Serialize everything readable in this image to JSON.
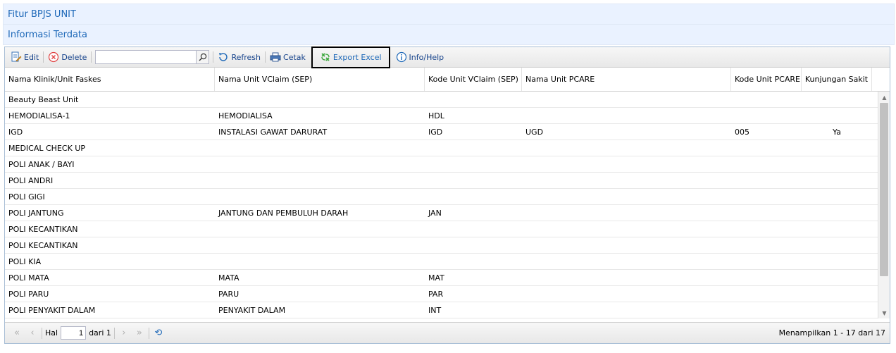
{
  "header": {
    "title": "Fitur BPJS UNIT",
    "subtitle": "Informasi Terdata"
  },
  "toolbar": {
    "edit_label": "Edit",
    "delete_label": "Delete",
    "search_value": "",
    "refresh_label": "Refresh",
    "print_label": "Cetak",
    "export_label": "Export Excel",
    "info_label": "Info/Help"
  },
  "grid": {
    "columns": [
      "Nama Klinik/Unit Faskes",
      "Nama Unit VClaim (SEP)",
      "Kode Unit VClaim (SEP)",
      "Nama Unit PCARE",
      "Kode Unit PCARE",
      "Kunjungan Sakit"
    ],
    "rows": [
      [
        "Beauty Beast Unit",
        "",
        "",
        "",
        "",
        ""
      ],
      [
        "HEMODIALISA-1",
        "HEMODIALISA",
        "HDL",
        "",
        "",
        ""
      ],
      [
        "IGD",
        "INSTALASI GAWAT DARURAT",
        "IGD",
        "UGD",
        "005",
        "Ya"
      ],
      [
        "MEDICAL CHECK UP",
        "",
        "",
        "",
        "",
        ""
      ],
      [
        "POLI ANAK / BAYI",
        "",
        "",
        "",
        "",
        ""
      ],
      [
        "POLI ANDRI",
        "",
        "",
        "",
        "",
        ""
      ],
      [
        "POLI GIGI",
        "",
        "",
        "",
        "",
        ""
      ],
      [
        "POLI JANTUNG",
        "JANTUNG DAN PEMBULUH DARAH",
        "JAN",
        "",
        "",
        ""
      ],
      [
        "POLI KECANTIKAN",
        "",
        "",
        "",
        "",
        ""
      ],
      [
        "POLI KECANTIKAN",
        "",
        "",
        "",
        "",
        ""
      ],
      [
        "POLI KIA",
        "",
        "",
        "",
        "",
        ""
      ],
      [
        "POLI MATA",
        "MATA",
        "MAT",
        "",
        "",
        ""
      ],
      [
        "POLI PARU",
        "PARU",
        "PAR",
        "",
        "",
        ""
      ],
      [
        "POLI PENYAKIT DALAM",
        "PENYAKIT DALAM",
        "INT",
        "",
        "",
        ""
      ]
    ]
  },
  "pager": {
    "page_label": "Hal",
    "page_value": "1",
    "of_label": "dari 1",
    "status": "Menampilkan 1 - 17 dari 17"
  },
  "colors": {
    "accent": "#1d68b8",
    "header_bg": "#eaf2ff"
  }
}
